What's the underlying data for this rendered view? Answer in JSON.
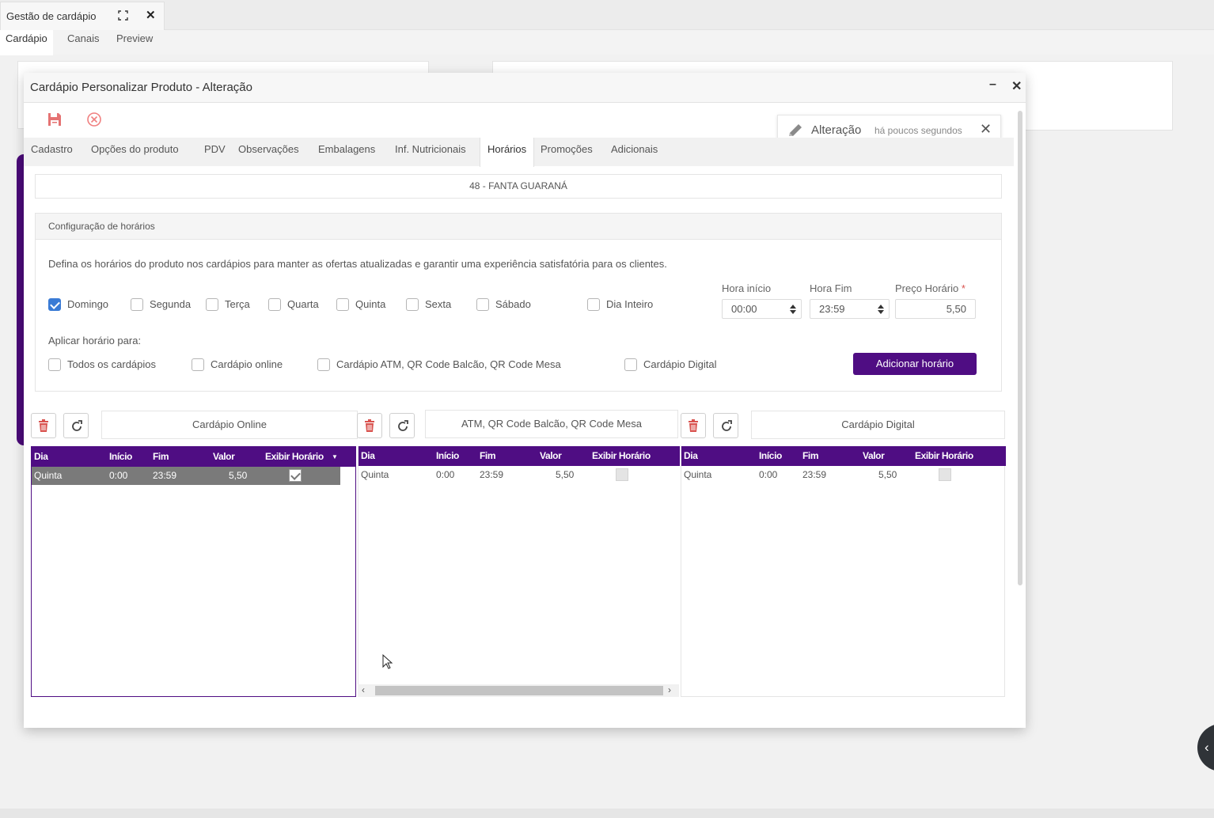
{
  "app_tab": {
    "title": "Gestão de cardápio"
  },
  "subnav": [
    "Cardápio",
    "Canais",
    "Preview"
  ],
  "modal": {
    "title": "Cardápio Personalizar Produto - Alteração",
    "notification": {
      "title": "Alteração",
      "time": "há poucos segundos"
    },
    "tabs": [
      "Cadastro",
      "Opções do produto",
      "PDV",
      "Observações",
      "Embalagens",
      "Inf. Nutricionais",
      "Horários",
      "Promoções",
      "Adicionais"
    ],
    "active_tab": "Horários",
    "product": "48 - FANTA GUARANÁ",
    "config": {
      "title": "Configuração de horários",
      "description": "Defina os horários do produto nos cardápios para manter as ofertas atualizadas e garantir uma experiência satisfatória para os clientes.",
      "days": [
        {
          "label": "Domingo",
          "checked": true
        },
        {
          "label": "Segunda",
          "checked": false
        },
        {
          "label": "Terça",
          "checked": false
        },
        {
          "label": "Quarta",
          "checked": false
        },
        {
          "label": "Quinta",
          "checked": false
        },
        {
          "label": "Sexta",
          "checked": false
        },
        {
          "label": "Sábado",
          "checked": false
        },
        {
          "label": "Dia Inteiro",
          "checked": false
        }
      ],
      "hora_inicio": {
        "label": "Hora início",
        "value": "00:00"
      },
      "hora_fim": {
        "label": "Hora Fim",
        "value": "23:59"
      },
      "preco": {
        "label": "Preço Horário",
        "required_mark": "*",
        "value": "5,50"
      },
      "apply_label": "Aplicar horário para:",
      "targets": [
        {
          "label": "Todos os cardápios",
          "checked": false
        },
        {
          "label": "Cardápio online",
          "checked": false
        },
        {
          "label": "Cardápio ATM, QR Code Balcão, QR Code Mesa",
          "checked": false
        },
        {
          "label": "Cardápio Digital",
          "checked": false
        }
      ],
      "add_button": "Adicionar horário"
    },
    "grids": [
      {
        "title": "Cardápio Online",
        "headers": [
          "Dia",
          "Início",
          "Fim",
          "Valor",
          "Exibir Horário"
        ],
        "sort_indicator": "▼",
        "rows": [
          {
            "dia": "Quinta",
            "inicio": "0:00",
            "fim": "23:59",
            "valor": "5,50",
            "exibir": true
          }
        ]
      },
      {
        "title": "ATM, QR Code Balcão, QR Code Mesa",
        "headers": [
          "Dia",
          "Início",
          "Fim",
          "Valor",
          "Exibir Horário"
        ],
        "rows": [
          {
            "dia": "Quinta",
            "inicio": "0:00",
            "fim": "23:59",
            "valor": "5,50",
            "exibir": false
          }
        ]
      },
      {
        "title": "Cardápio Digital",
        "headers": [
          "Dia",
          "Início",
          "Fim",
          "Valor",
          "Exibir Horário"
        ],
        "rows": [
          {
            "dia": "Quinta",
            "inicio": "0:00",
            "fim": "23:59",
            "valor": "5,50",
            "exibir": false
          }
        ]
      }
    ]
  },
  "colors": {
    "brand": "#4f0d83",
    "delete": "#d9534f",
    "checkbox": "#3a7bd5"
  }
}
